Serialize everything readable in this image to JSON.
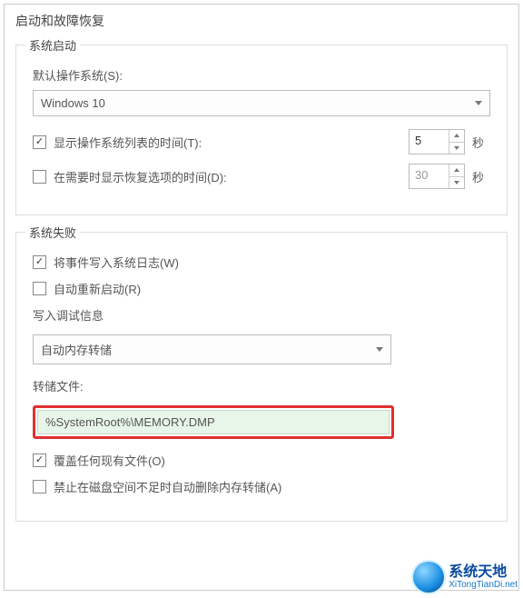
{
  "dialog": {
    "title": "启动和故障恢复"
  },
  "startup": {
    "group_label": "系统启动",
    "default_os_label": "默认操作系统(S):",
    "default_os_value": "Windows 10",
    "show_list_label": "显示操作系统列表的时间(T):",
    "show_list_value": "5",
    "show_list_unit": "秒",
    "show_recovery_label": "在需要时显示恢复选项的时间(D):",
    "show_recovery_value": "30",
    "show_recovery_unit": "秒"
  },
  "failure": {
    "group_label": "系统失败",
    "write_log_label": "将事件写入系统日志(W)",
    "auto_restart_label": "自动重新启动(R)",
    "debug_info_label": "写入调试信息",
    "debug_select_value": "自动内存转储",
    "dump_file_label": "转储文件:",
    "dump_file_value": "%SystemRoot%\\MEMORY.DMP",
    "overwrite_label": "覆盖任何现有文件(O)",
    "no_auto_delete_label": "禁止在磁盘空间不足时自动删除内存转储(A)"
  },
  "watermark": {
    "main": "系统天地",
    "sub": "XiTongTianDi.net"
  }
}
